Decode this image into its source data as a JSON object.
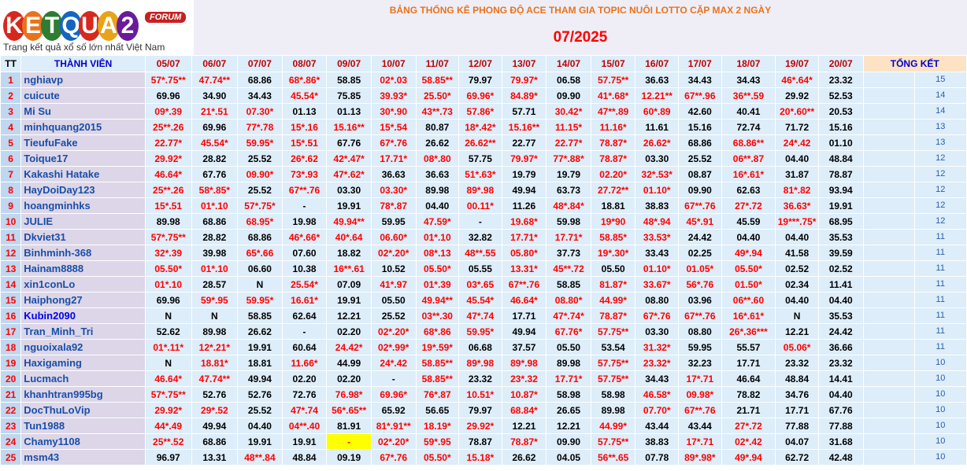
{
  "logo": {
    "letters": [
      "K",
      "E",
      "T",
      "Q",
      "U",
      "A",
      "2"
    ],
    "letter_colors": [
      "#d7281d",
      "#e8731c",
      "#2e7d32",
      "#1565c0",
      "#d7281d",
      "#e8a317",
      "#6a1b9a"
    ],
    "forum": "FORUM",
    "slogan": "Trang kết quả xổ số lớn nhất Việt Nam"
  },
  "banner": {
    "title": "BẢNG THỐNG KÊ PHONG ĐỘ ACE THAM GIA TOPIC NUÔI LOTTO CẶP MAX 2 NGÀY",
    "date": "07/2025"
  },
  "table": {
    "headers": {
      "tt": "TT",
      "member": "THÀNH VIÊN",
      "days": [
        "05/07",
        "06/07",
        "07/07",
        "08/07",
        "09/07",
        "10/07",
        "11/07",
        "12/07",
        "13/07",
        "14/07",
        "15/07",
        "16/07",
        "17/07",
        "18/07",
        "19/07",
        "20/07"
      ],
      "total": "TỔNG KẾT"
    },
    "rows": [
      {
        "tt": "1",
        "member": "nghiavp",
        "cells": [
          "57*.75**",
          "47.74**",
          "68.86",
          "68*.86*",
          "58.85",
          "02*.03",
          "58.85**",
          "79.97",
          "79.97*",
          "06.58",
          "57.75**",
          "36.63",
          "34.43",
          "34.43",
          "46*.64*",
          "23.32"
        ],
        "total": "15"
      },
      {
        "tt": "2",
        "member": "cuicute",
        "cells": [
          "69.96",
          "34.90",
          "34.43",
          "45.54*",
          "75.85",
          "39.93*",
          "25.50*",
          "69.96*",
          "84.89*",
          "09.90",
          "41*.68*",
          "12.21**",
          "67**.96",
          "36**.59",
          "29.92",
          "52.53"
        ],
        "total": "14"
      },
      {
        "tt": "3",
        "member": "Mi Su",
        "cells": [
          "09*.39",
          "21*.51",
          "07.30*",
          "01.13",
          "01.13",
          "30*.90",
          "43**.73",
          "57.86*",
          "57.71",
          "30.42*",
          "47**.89",
          "60*.89",
          "42.60",
          "40.41",
          "20*.60**",
          "20.53"
        ],
        "total": "14"
      },
      {
        "tt": "4",
        "member": "minhquang2015",
        "cells": [
          "25**.26",
          "69.96",
          "77*.78",
          "15*.16",
          "15.16**",
          "15*.54",
          "80.87",
          "18*.42*",
          "15.16**",
          "11.15*",
          "11.16*",
          "11.61",
          "15.16",
          "72.74",
          "71.72",
          "15.16"
        ],
        "total": "13"
      },
      {
        "tt": "5",
        "member": "TieufuFake",
        "cells": [
          "22.77*",
          "45.54*",
          "59.95*",
          "15*.51",
          "67.76",
          "67*.76",
          "26.62",
          "26.62**",
          "22.77",
          "22.77*",
          "78.87*",
          "26.62*",
          "68.86",
          "68.86**",
          "24*.42",
          "01.10"
        ],
        "total": "13"
      },
      {
        "tt": "6",
        "member": "Toique17",
        "cells": [
          "29.92*",
          "28.82",
          "25.52",
          "26*.62",
          "42*.47*",
          "17.71*",
          "08*.80",
          "57.75",
          "79.97*",
          "77*.88*",
          "78.87*",
          "03.30",
          "25.52",
          "06**.87",
          "04.40",
          "48.84"
        ],
        "total": "12"
      },
      {
        "tt": "7",
        "member": "Kakashi Hatake",
        "cells": [
          "46.64*",
          "67.76",
          "09.90*",
          "73*.93",
          "47*.62*",
          "36.63",
          "36.63",
          "51*.63*",
          "19.79",
          "19.79",
          "02.20*",
          "32*.53*",
          "08.87",
          "16*.61*",
          "31.87",
          "78.87"
        ],
        "total": "12"
      },
      {
        "tt": "8",
        "member": "HayDoiDay123",
        "cells": [
          "25**.26",
          "58*.85*",
          "25.52",
          "67**.76",
          "03.30",
          "03.30*",
          "89.98",
          "89*.98",
          "49.94",
          "63.73",
          "27.72**",
          "01.10*",
          "09.90",
          "62.63",
          "81*.82",
          "93.94"
        ],
        "total": "12"
      },
      {
        "tt": "9",
        "member": "hoangminhks",
        "cells": [
          "15*.51",
          "01*.10",
          "57*.75*",
          "-",
          "19.91",
          "78*.87",
          "04.40",
          "00.11*",
          "11.26",
          "48*.84*",
          "18.81",
          "38.83",
          "67**.76",
          "27*.72",
          "36.63*",
          "19.91"
        ],
        "total": "12"
      },
      {
        "tt": "10",
        "member": "JULIE",
        "cells": [
          "89.98",
          "68.86",
          "68.95*",
          "19.98",
          "49.94**",
          "59.95",
          "47.59*",
          "-",
          "19.68*",
          "59.98",
          "19*90",
          "48*.94",
          "45*.91",
          "45.59",
          "19***.75*",
          "68.95"
        ],
        "total": "12"
      },
      {
        "tt": "11",
        "member": "Dkviet31",
        "cells": [
          "57*.75**",
          "28.82",
          "68.86",
          "46*.66*",
          "40*.64",
          "06.60*",
          "01*.10",
          "32.82",
          "17.71*",
          "17.71*",
          "58.85*",
          "33.53*",
          "24.42",
          "04.40",
          "04.40",
          "35.53"
        ],
        "total": "11"
      },
      {
        "tt": "12",
        "member": "Binhminh-368",
        "cells": [
          "32*.39",
          "39.98",
          "65*.66",
          "07.60",
          "18.82",
          "02*.20*",
          "08*.13",
          "48**.55",
          "05.80*",
          "37.73",
          "19*.30*",
          "33.43",
          "02.25",
          "49*.94",
          "41.58",
          "39.59"
        ],
        "total": "11"
      },
      {
        "tt": "13",
        "member": "Hainam8888",
        "cells": [
          "05.50*",
          "01*.10",
          "06.60",
          "10.38",
          "16**.61",
          "10.52",
          "05.50*",
          "05.55",
          "13.31*",
          "45**.72",
          "05.50",
          "01.10*",
          "01.05*",
          "05.50*",
          "02.52",
          "02.52"
        ],
        "total": "11"
      },
      {
        "tt": "14",
        "member": "xin1conLo",
        "cells": [
          "01*.10",
          "28.57",
          "N",
          "25.54*",
          "07.09",
          "41*.97",
          "01*.39",
          "03*.65",
          "67**.76",
          "58.85",
          "81.87*",
          "33.67*",
          "56*.76",
          "01.50*",
          "02.34",
          "11.41"
        ],
        "total": "11"
      },
      {
        "tt": "15",
        "member": "Haiphong27",
        "cells": [
          "69.96",
          "59*.95",
          "59.95*",
          "16.61*",
          "19.91",
          "05.50",
          "49.94**",
          "45.54*",
          "46.64*",
          "08.80*",
          "44.99*",
          "08.80",
          "03.96",
          "06**.60",
          "04.40",
          "04.40"
        ],
        "total": "11"
      },
      {
        "tt": "16",
        "member": "Kubin2090",
        "cells": [
          "N",
          "N",
          "58.85",
          "62.64",
          "12.21",
          "25.52",
          "03**.30",
          "47*.74",
          "17.71",
          "47*.74*",
          "78.87*",
          "67*.76",
          "67**.76",
          "16*.61*",
          "N",
          "35.53"
        ],
        "total": "11"
      },
      {
        "tt": "17",
        "member": "Tran_Minh_Tri",
        "cells": [
          "52.62",
          "89.98",
          "26.62",
          "-",
          "02.20",
          "02*.20*",
          "68*.86",
          "59.95*",
          "49.94",
          "67.76*",
          "57.75**",
          "03.30",
          "08.80",
          "26*.36***",
          "12.21",
          "24.42"
        ],
        "total": "11"
      },
      {
        "tt": "18",
        "member": "nguoixala92",
        "cells": [
          "01*.11*",
          "12*.21*",
          "19.91",
          "60.64",
          "24.42*",
          "02*.99*",
          "19*.59*",
          "06.68",
          "37.57",
          "05.50",
          "53.54",
          "31.32*",
          "59.95",
          "55.57",
          "05.06*",
          "36.66"
        ],
        "total": "11"
      },
      {
        "tt": "19",
        "member": "Haxigaming",
        "cells": [
          "N",
          "18.81*",
          "18.81",
          "11.66*",
          "44.99",
          "24*.42",
          "58.85**",
          "89*.98",
          "89*.98",
          "89.98",
          "57.75**",
          "23.32*",
          "32.23",
          "17.71",
          "23.32",
          "23.32"
        ],
        "total": "10"
      },
      {
        "tt": "20",
        "member": "Lucmach",
        "cells": [
          "46.64*",
          "47.74**",
          "49.94",
          "02.20",
          "02.20",
          "-",
          "58.85**",
          "23.32",
          "23*.32",
          "17.71*",
          "57.75**",
          "34.43",
          "17*.71",
          "46.64",
          "48.84",
          "14.41"
        ],
        "total": "10"
      },
      {
        "tt": "21",
        "member": "khanhtran995bg",
        "cells": [
          "57*.75**",
          "52.76",
          "52.76",
          "72.76",
          "76.98*",
          "69.96*",
          "76*.87",
          "10.51*",
          "10.87*",
          "58.98",
          "58.98",
          "46.58*",
          "09.98*",
          "78.82",
          "34.76",
          "04.40"
        ],
        "total": "10"
      },
      {
        "tt": "22",
        "member": "DocThuLoVip",
        "cells": [
          "29.92*",
          "29*.52",
          "25.52",
          "47*.74",
          "56*.65**",
          "65.92",
          "56.65",
          "79.97",
          "68.84*",
          "26.65",
          "89.98",
          "07.70*",
          "67**.76",
          "21.71",
          "17.71",
          "67.76"
        ],
        "total": "10"
      },
      {
        "tt": "23",
        "member": "Tun1988",
        "cells": [
          "44*.49",
          "49.94",
          "04.40",
          "04**.40",
          "81.91",
          "81*.91**",
          "18.19*",
          "29.92*",
          "12.21",
          "12.21",
          "44.99*",
          "43.44",
          "43.44",
          "27*.72",
          "77.88",
          "77.88"
        ],
        "total": "10"
      },
      {
        "tt": "24",
        "member": "Chamy1108",
        "cells": [
          "25**.52",
          "68.86",
          "19.91",
          "19.91",
          "-",
          "02*.20*",
          "59*.95",
          "78.87",
          "78.87*",
          "09.90",
          "57.75**",
          "38.83",
          "17*.71",
          "02*.42",
          "04.07",
          "31.68"
        ],
        "total": "10"
      },
      {
        "tt": "25",
        "member": "msm43",
        "cells": [
          "96.97",
          "13.31",
          "48**.84",
          "48.84",
          "09.19",
          "67*.76",
          "05.50*",
          "15.18*",
          "26.62",
          "04.05",
          "56**.65",
          "07.78",
          "89*.98*",
          "49*.94",
          "62.72",
          "42.48"
        ],
        "total": "10"
      }
    ]
  },
  "colors": {
    "header_bg": "#ddedf9",
    "member_bg": "#dcd6e8",
    "tt_bg": "#bfd7ef",
    "total_header_bg": "#fde3c4",
    "hit_text": "#ff0000",
    "member_text": "#1a4ea8",
    "highlight_cell": "#ffff00",
    "title_orange": "#e8731c"
  }
}
